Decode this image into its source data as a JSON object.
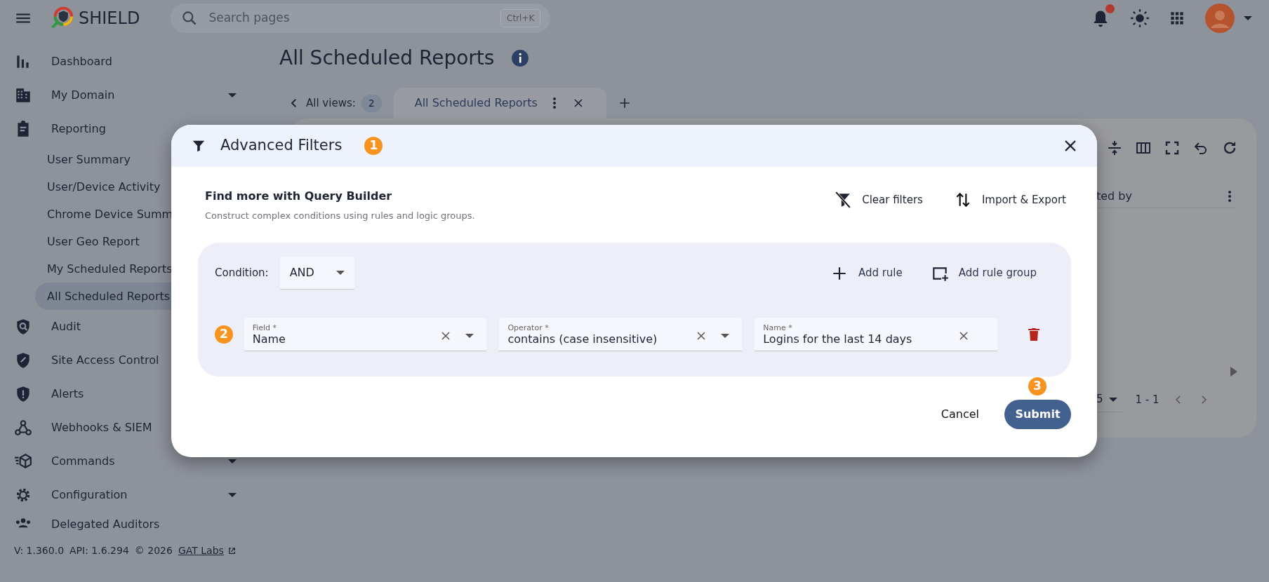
{
  "header": {
    "app_name": "SHIELD",
    "search": {
      "placeholder": "Search pages",
      "shortcut": "Ctrl+K"
    },
    "notifications_unread": true
  },
  "sidebar": {
    "items": [
      {
        "label": "Dashboard",
        "expandable": false
      },
      {
        "label": "My Domain",
        "expandable": true
      },
      {
        "label": "Reporting",
        "children": [
          {
            "label": "User Summary",
            "selected": false
          },
          {
            "label": "User/Device Activity",
            "selected": false
          },
          {
            "label": "Chrome Device Summ",
            "selected": false
          },
          {
            "label": "User Geo Report",
            "selected": false
          },
          {
            "label": "My Scheduled Reports",
            "selected": false
          },
          {
            "label": "All Scheduled Reports",
            "selected": true
          }
        ]
      },
      {
        "label": "Audit"
      },
      {
        "label": "Site Access Control"
      },
      {
        "label": "Alerts"
      },
      {
        "label": "Webhooks & SIEM"
      },
      {
        "label": "Commands",
        "expandable": true
      },
      {
        "label": "Configuration",
        "expandable": true
      },
      {
        "label": "Delegated Auditors",
        "expandable": false
      }
    ]
  },
  "footer": {
    "version": "V: 1.360.0",
    "api": "API: 1.6.294",
    "copyright": "© 2026",
    "link": "GAT Labs"
  },
  "page": {
    "title": "All Scheduled Reports",
    "views": {
      "label": "All views:",
      "count": "2"
    },
    "tabs": [
      {
        "label": "All Scheduled Reports"
      }
    ],
    "table": {
      "columns": [
        {
          "label": "ted by"
        }
      ],
      "pagination": {
        "page_size": "5",
        "range": "1 - 1"
      }
    }
  },
  "dialog": {
    "title": "Advanced Filters",
    "annotation": "1",
    "heading": "Find more with Query Builder",
    "description": "Construct complex conditions using rules and logic groups.",
    "actions": [
      {
        "label": "Clear filters"
      },
      {
        "label": "Import & Export"
      }
    ],
    "group": {
      "condition_label": "Condition:",
      "condition": "AND",
      "actions": [
        {
          "label": "Add rule"
        },
        {
          "label": "Add rule group"
        }
      ],
      "rules": [
        {
          "annotation": "2",
          "fields": [
            {
              "label": "Field *",
              "value": "Name",
              "dropdown": true
            },
            {
              "label": "Operator *",
              "value": "contains (case insensitive)",
              "dropdown": true
            },
            {
              "label": "Name *",
              "value": "Logins for the last 14 days",
              "dropdown": false
            }
          ]
        }
      ]
    },
    "cancel": "Cancel",
    "submit": {
      "label": "Submit",
      "annotation": "3"
    }
  }
}
